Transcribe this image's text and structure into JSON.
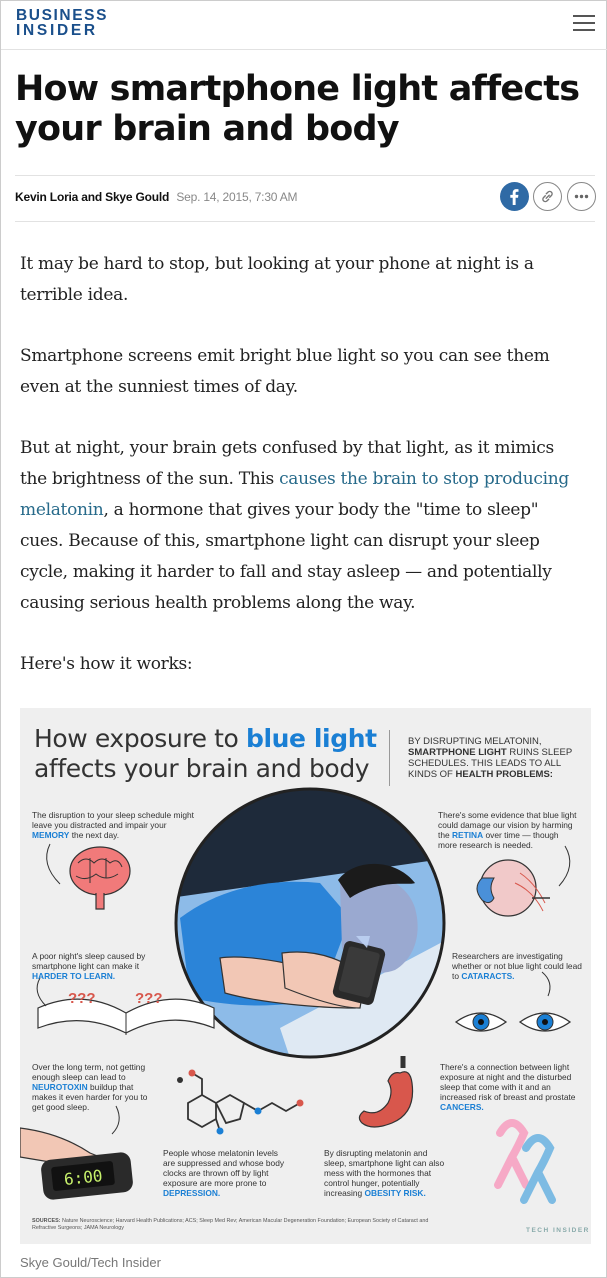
{
  "header": {
    "logo_line1": "BUSINESS",
    "logo_line2": "INSIDER",
    "menu_icon": "hamburger-menu-icon"
  },
  "article": {
    "headline_line1": "How smartphone light affects",
    "headline_line2": "your brain and body",
    "authors": "Kevin Loria and Skye Gould",
    "date": "Sep. 14, 2015, 7:30 AM",
    "share": {
      "facebook_icon": "facebook-icon",
      "link_icon": "link-icon",
      "more_icon": "more-options-icon"
    },
    "paragraphs": {
      "p1": "It may be hard to stop, but looking at your phone at night is a terrible idea.",
      "p2": "Smartphone screens emit bright blue light so you can see them even at the sunniest times of day.",
      "p3_before": "But at night, your brain gets confused by that light, as it mimics the brightness of the sun. This ",
      "p3_link": "causes the brain to stop producing melatonin",
      "p3_after": ", a hormone that gives your body the \"time to sleep\" cues. Because of this, smartphone light can disrupt your sleep cycle, making it harder to fall and stay asleep — and potentially causing serious health problems along the way.",
      "p4": "Here's how it works:"
    },
    "image_caption": "Skye Gould/Tech Insider"
  },
  "infographic": {
    "title_pre": "How exposure to ",
    "title_blue": "blue light",
    "title_line2": "affects your brain and body",
    "subtitle_a": "By disrupting melatonin, ",
    "subtitle_b": "smartphone light",
    "subtitle_c": " ruins sleep schedules. This leads to all kinds of ",
    "subtitle_d": "health problems:",
    "notes": {
      "memory_a": "The disruption to your sleep schedule might leave you distracted and impair your ",
      "memory_hl": "memory",
      "memory_b": " the next day.",
      "retina_a": "There's some evidence that blue light could damage our vision by harming the ",
      "retina_hl": "retina",
      "retina_b": " over time — though more research is needed.",
      "learn_a": "A poor night's sleep caused by smartphone light can make it ",
      "learn_hl": "harder to learn.",
      "cataract_a": "Researchers are investigating whether or not blue light could lead to ",
      "cataract_hl": "cataracts.",
      "neuro_a": "Over the long term, not getting enough sleep can lead to ",
      "neuro_hl": "neurotoxin",
      "neuro_b": " buildup that makes it even harder for you to get good sleep.",
      "depress_a": "People whose melatonin levels are suppressed and whose body clocks are thrown off by light exposure are more prone to ",
      "depress_hl": "depression.",
      "obesity_a": "By disrupting melatonin and sleep, smartphone light can also mess with the hormones that control hunger, potentially increasing ",
      "obesity_hl": "obesity risk.",
      "cancer_a": "There's a connection between light exposure at night and the disturbed sleep that come with it and an increased risk of breast and prostate ",
      "cancer_hl": "cancers."
    },
    "clock_time": "6:00",
    "sources_label": "SOURCES:",
    "sources_text": " Nature Neuroscience; Harvard Health Publications; ACS; Sleep Med Rev; American Macular Degeneration Foundation; European Society of Cataract and Refractive Surgeons; JAMA Neurology",
    "logo": "TECH INSIDER",
    "colors": {
      "accent_blue": "#1a7fd4",
      "brain_pink": "#f17a7a",
      "stomach_red": "#d8574c",
      "ribbon_pink": "#f6a9c6",
      "ribbon_blue": "#7dbbe3"
    }
  }
}
